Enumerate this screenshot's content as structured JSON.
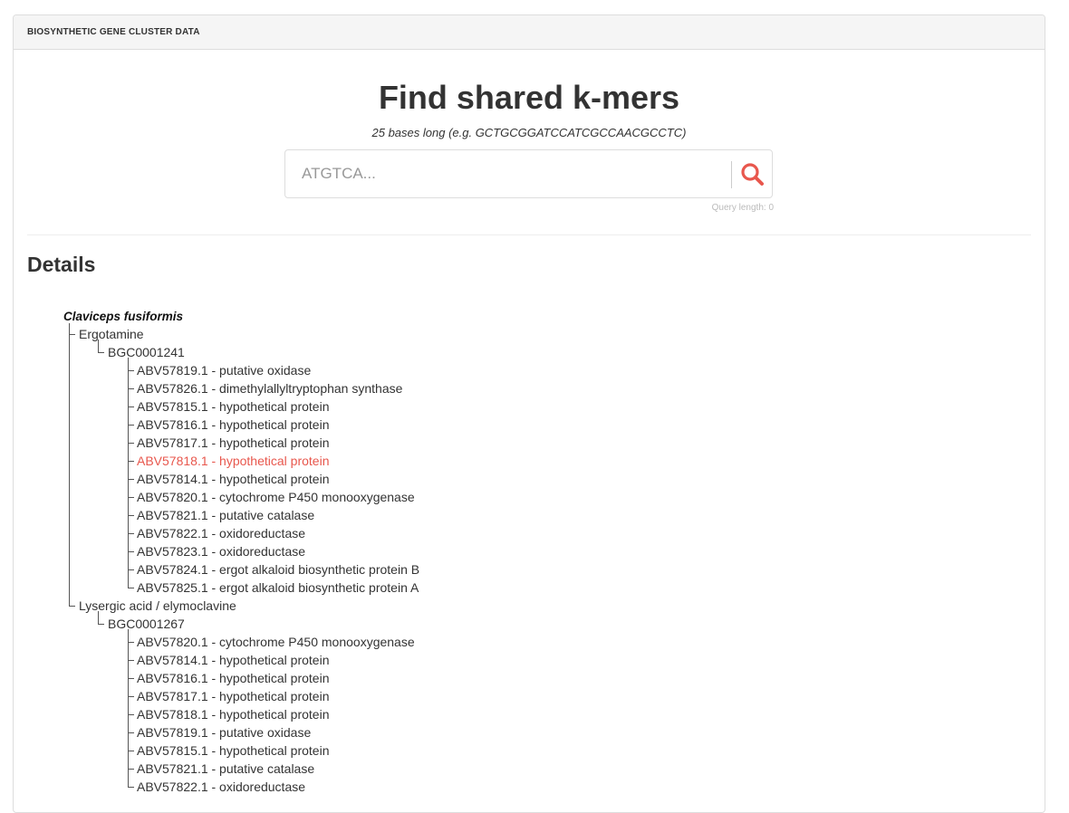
{
  "panel": {
    "heading": "BIOSYNTHETIC GENE CLUSTER DATA"
  },
  "hero": {
    "title": "Find shared k-mers",
    "subtitle": "25 bases long (e.g. GCTGCGGATCCATCGCCAACGCCTC)",
    "search_placeholder": "ATGTCA...",
    "search_value": "",
    "query_length": "Query length: 0",
    "search_icon": "search-icon",
    "accent_color": "#e8574d"
  },
  "details": {
    "title": "Details",
    "organism": "Claviceps fusiformis",
    "compounds": [
      {
        "name": "Ergotamine",
        "cluster": "BGC0001241",
        "genes": [
          "ABV57819.1 - putative oxidase",
          "ABV57826.1 - dimethylallyltryptophan synthase",
          "ABV57815.1 - hypothetical protein",
          "ABV57816.1 - hypothetical protein",
          "ABV57817.1 - hypothetical protein",
          "ABV57818.1 - hypothetical protein",
          "ABV57814.1 - hypothetical protein",
          "ABV57820.1 - cytochrome P450 monooxygenase",
          "ABV57821.1 - putative catalase",
          "ABV57822.1 - oxidoreductase",
          "ABV57823.1 - oxidoreductase",
          "ABV57824.1 - ergot alkaloid biosynthetic protein B",
          "ABV57825.1 - ergot alkaloid biosynthetic protein A"
        ],
        "highlighted_gene": "ABV57818.1 - hypothetical protein"
      },
      {
        "name": "Lysergic acid / elymoclavine",
        "cluster": "BGC0001267",
        "genes": [
          "ABV57820.1 - cytochrome P450 monooxygenase",
          "ABV57814.1 - hypothetical protein",
          "ABV57816.1 - hypothetical protein",
          "ABV57817.1 - hypothetical protein",
          "ABV57818.1 - hypothetical protein",
          "ABV57819.1 - putative oxidase",
          "ABV57815.1 - hypothetical protein",
          "ABV57821.1 - putative catalase",
          "ABV57822.1 - oxidoreductase"
        ],
        "highlighted_gene": ""
      }
    ]
  }
}
